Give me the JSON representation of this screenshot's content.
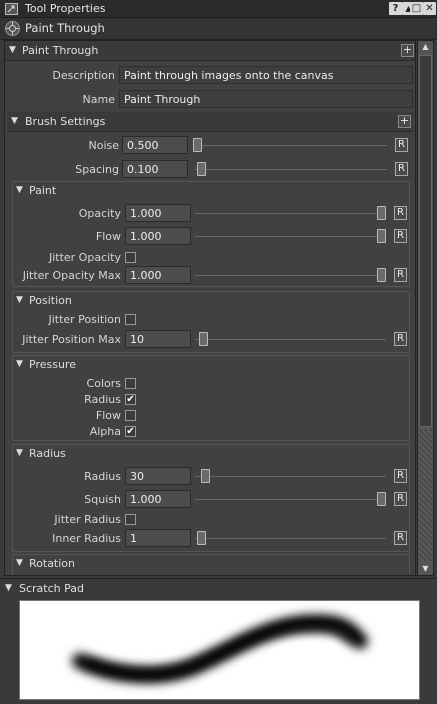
{
  "window": {
    "title": "Tool Properties",
    "tool_name": "Paint Through",
    "buttons": [
      "?",
      "▲",
      "□",
      "✕"
    ]
  },
  "paint_through": {
    "header": "Paint Through",
    "description_label": "Description",
    "description_value": "Paint through images onto the canvas",
    "name_label": "Name",
    "name_value": "Paint Through"
  },
  "brush_settings": {
    "header": "Brush Settings",
    "noise": {
      "label": "Noise",
      "value": "0.500",
      "level": 0
    },
    "spacing": {
      "label": "Spacing",
      "value": "0.100",
      "level": 0.02
    }
  },
  "paint": {
    "header": "Paint",
    "opacity": {
      "label": "Opacity",
      "value": "1.000",
      "level": 1
    },
    "flow": {
      "label": "Flow",
      "value": "1.000",
      "level": 1
    },
    "jitter_opacity": {
      "label": "Jitter Opacity",
      "checked": false
    },
    "jitter_opacity_max": {
      "label": "Jitter Opacity Max",
      "value": "1.000",
      "level": 1
    }
  },
  "position": {
    "header": "Position",
    "jitter_position": {
      "label": "Jitter Position",
      "checked": false
    },
    "jitter_position_max": {
      "label": "Jitter Position Max",
      "value": "10",
      "level": 0.02
    }
  },
  "pressure": {
    "header": "Pressure",
    "colors": {
      "label": "Colors",
      "checked": false
    },
    "radius": {
      "label": "Radius",
      "checked": true
    },
    "flow": {
      "label": "Flow",
      "checked": false
    },
    "alpha": {
      "label": "Alpha",
      "checked": true
    }
  },
  "radius": {
    "header": "Radius",
    "radius": {
      "label": "Radius",
      "value": "30",
      "level": 0.03
    },
    "squish": {
      "label": "Squish",
      "value": "1.000",
      "level": 1
    },
    "jitter_radius": {
      "label": "Jitter Radius",
      "checked": false
    },
    "inner_radius": {
      "label": "Inner Radius",
      "value": "1",
      "level": 0
    }
  },
  "rotation": {
    "header": "Rotation"
  },
  "scratch_pad": {
    "header": "Scratch Pad"
  },
  "reset_label": "R",
  "plus_label": "+",
  "check_mark": "✔"
}
